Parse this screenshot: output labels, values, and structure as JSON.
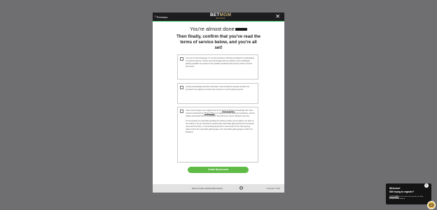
{
  "modal": {
    "previous_label": "Previous",
    "logo": {
      "bet": "BET",
      "mgm": "MGM",
      "sub": "BETMGM"
    },
    "close_glyph": "✕",
    "heading1": "You're almost done",
    "heading2": "Then finally, confirm that you've read the terms of service below, and you're all set!",
    "box1_text": "I am over 21 and of legal age. I'm not self-excluded or otherwise prohibited from participating in interactive gaming. I declare and acknowledge that any violations of the identification gaming regulations are subject to the penalties provided by law and may result in criminal prosecution.",
    "box2_text": "I hereby acknowledge that all the information I have provided is accurate and that I am permitted to be wagering on online sites to access or use this gaming account.",
    "box3_text_a": "I have read and agree to be legally bound by the",
    "box3_link_terms": "Terms of Service",
    "box3_text_b": "acknowledge that I have read and understand the",
    "box3_link_privacy": "Privacy Policy",
    "box3_text_c": "and I agree to receive email and newsletters, account updates and special offers from BetMGM. My preferences can be changed at any time.",
    "box3_text_d": "For the purposes of responsible gambling the website provides you the ability to set limits on your activity. If you are interested in implementing responsible gaming limits such as deposit, spend and time limits, or self-excluding all periods or self-exclusion from online gaming, please look for the responsible gaming page in the responsible gaming page to confirm the limitations.",
    "button_label": "Create My Account"
  },
  "footer": {
    "help_label": "Help & Contact",
    "separator": "|",
    "responsible_label": "Responsible Gaming",
    "age_badge": "21+",
    "copyright": "Copyright © 2024"
  },
  "chat": {
    "close_glyph": "×",
    "line1": "Welcome!",
    "line2": "Still trying to register?",
    "cta": "CLICK HERE",
    "body": " to chat with a live rep who can help you get started playing."
  }
}
